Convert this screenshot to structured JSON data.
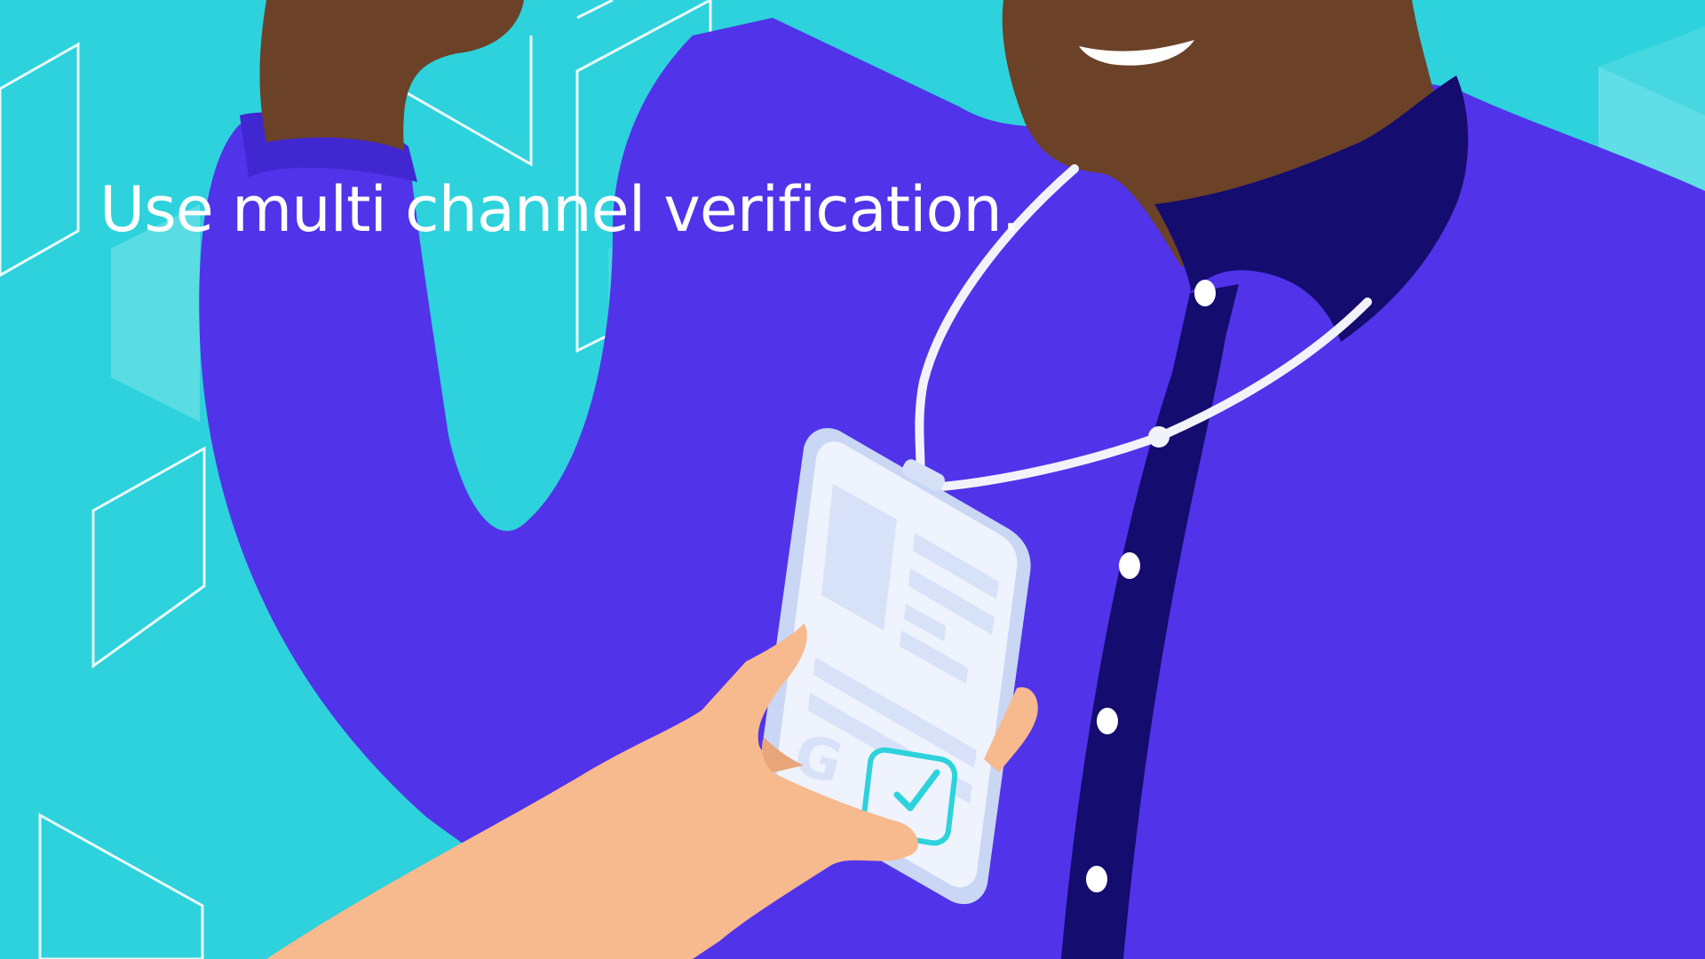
{
  "caption": "Use multi channel verification.",
  "badge_logo_letter": "G",
  "colors": {
    "background": "#2dd2dc",
    "shirt": "#5133ea",
    "placket": "#140c6e",
    "skin_dark": "#6b4128",
    "skin_light": "#f7b98e",
    "badge": "#eef3fd",
    "badge_accent": "#2dd2dc",
    "outline": "#ffffff"
  },
  "icons": [
    "person-illustration",
    "id-badge-icon",
    "check-icon",
    "google-logo"
  ]
}
